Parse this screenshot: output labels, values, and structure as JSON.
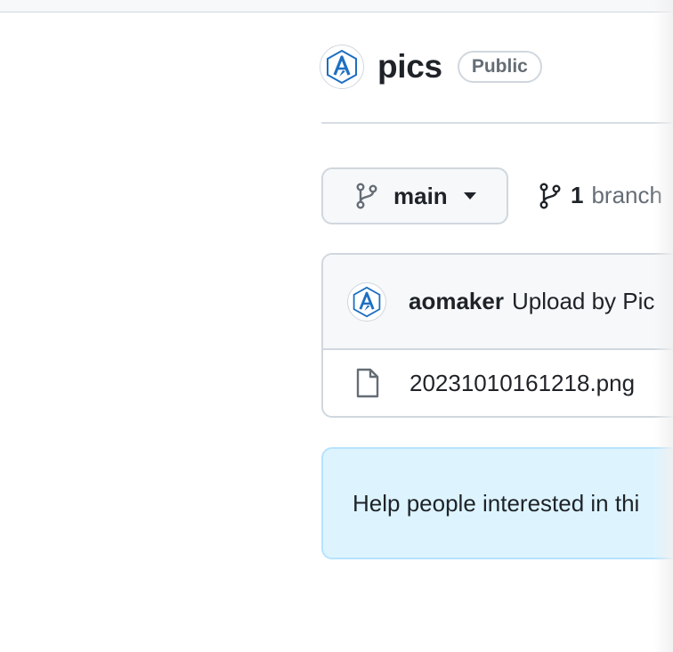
{
  "repo": {
    "name": "pics",
    "visibility": "Public",
    "owner_avatar": "owner-logo-icon"
  },
  "branch_selector": {
    "current": "main",
    "icon": "git-branch-icon",
    "caret": "triangle-down-icon"
  },
  "branches": {
    "count": "1",
    "label": "branch"
  },
  "latest_commit": {
    "author": "aomaker",
    "message": "Upload by Pic"
  },
  "files": [
    {
      "name": "20231010161218.png",
      "icon": "file-icon"
    }
  ],
  "help_banner": {
    "text": "Help people interested in thi"
  },
  "colors": {
    "accent_logo": "#1e6fc2",
    "border": "#d0d7de",
    "banner_bg": "#ddf4ff",
    "muted_text": "#656d76"
  }
}
